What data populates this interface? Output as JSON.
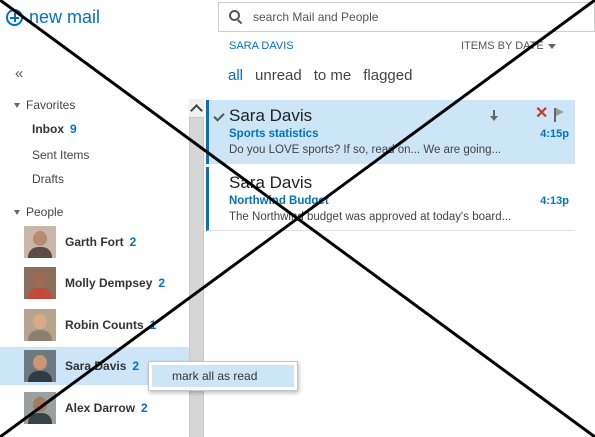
{
  "header": {
    "new_mail_label": "new mail"
  },
  "search": {
    "placeholder": "search Mail and People"
  },
  "folder": {
    "title": "SARA DAVIS",
    "sort_label": "ITEMS BY DATE"
  },
  "filters": [
    {
      "label": "all",
      "active": true
    },
    {
      "label": "unread",
      "active": false
    },
    {
      "label": "to me",
      "active": false
    },
    {
      "label": "flagged",
      "active": false
    }
  ],
  "nav": {
    "collapse_glyph": "«",
    "favorites_label": "Favorites",
    "items": [
      {
        "label": "Inbox",
        "count": "9"
      },
      {
        "label": "Sent Items"
      },
      {
        "label": "Drafts"
      }
    ],
    "people_label": "People",
    "people": [
      {
        "name": "Garth Fort",
        "count": "2"
      },
      {
        "name": "Molly Dempsey",
        "count": "2"
      },
      {
        "name": "Robin Counts",
        "count": "1"
      },
      {
        "name": "Sara Davis",
        "count": "2"
      },
      {
        "name": "Alex Darrow",
        "count": "2"
      }
    ]
  },
  "messages": [
    {
      "sender": "Sara Davis",
      "subject": "Sports statistics",
      "preview": "Do you LOVE sports?    If so, read on...      We are going...",
      "time": "4:15p"
    },
    {
      "sender": "Sara Davis",
      "subject": "Northwind Budget",
      "preview": "The Northwind budget was approved at today's board...",
      "time": "4:13p"
    }
  ],
  "context_menu": {
    "item": "mark all as read"
  },
  "icons": {
    "new_mail": "plus-circle-icon",
    "search": "search-icon",
    "delete": "delete-x-icon",
    "flag": "flag-icon",
    "move_down": "arrow-down-icon",
    "read_check": "check-icon"
  },
  "colors": {
    "accent": "#0072c6",
    "selection": "#cde6f7",
    "delete": "#c0392b"
  }
}
